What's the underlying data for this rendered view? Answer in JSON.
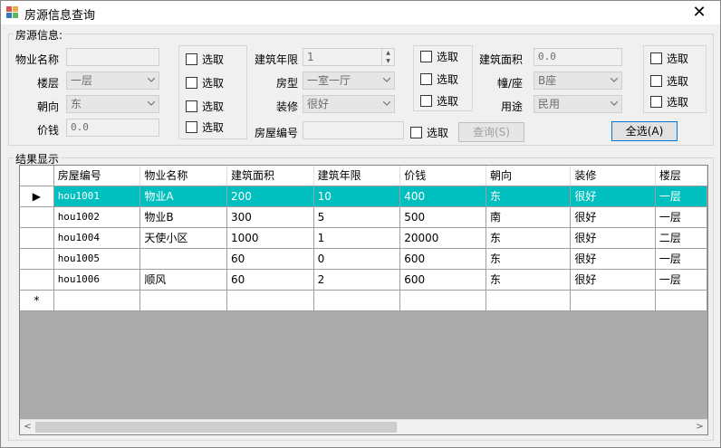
{
  "window": {
    "title": "房源信息查询"
  },
  "search_group": {
    "title": "房源信息:"
  },
  "fields": {
    "property_name": {
      "label": "物业名称",
      "value": ""
    },
    "floor": {
      "label": "楼层",
      "value": "一层"
    },
    "orientation": {
      "label": "朝向",
      "value": "东"
    },
    "price": {
      "label": "价钱",
      "value": "0.0"
    },
    "build_years": {
      "label": "建筑年限",
      "value": "1"
    },
    "room_type": {
      "label": "房型",
      "value": "一室一厅"
    },
    "decoration": {
      "label": "装修",
      "value": "很好"
    },
    "house_no": {
      "label": "房屋编号",
      "value": ""
    },
    "build_area": {
      "label": "建筑面积",
      "value": "0.0"
    },
    "building": {
      "label": "幢/座",
      "value": "B座"
    },
    "usage": {
      "label": "用途",
      "value": "民用"
    }
  },
  "checkbox_label": "选取",
  "buttons": {
    "query": "查询(S)",
    "select_all": "全选(A)"
  },
  "results_group": {
    "title": "结果显示"
  },
  "table": {
    "columns": [
      "房屋编号",
      "物业名称",
      "建筑面积",
      "建筑年限",
      "价钱",
      "朝向",
      "装修",
      "楼层"
    ],
    "rows": [
      [
        "hou1001",
        "物业A",
        "200",
        "10",
        "400",
        "东",
        "很好",
        "一层"
      ],
      [
        "hou1002",
        "物业B",
        "300",
        "5",
        "500",
        "南",
        "很好",
        "一层"
      ],
      [
        "hou1004",
        "天使小区",
        "1000",
        "1",
        "20000",
        "东",
        "很好",
        "二层"
      ],
      [
        "hou1005",
        "",
        "60",
        "0",
        "600",
        "东",
        "很好",
        "一层"
      ],
      [
        "hou1006",
        "顺风",
        "60",
        "2",
        "600",
        "东",
        "很好",
        "一层"
      ]
    ],
    "new_row_marker": "*",
    "current_row_marker": "▶"
  },
  "colors": {
    "selection": "#00bfbf"
  }
}
